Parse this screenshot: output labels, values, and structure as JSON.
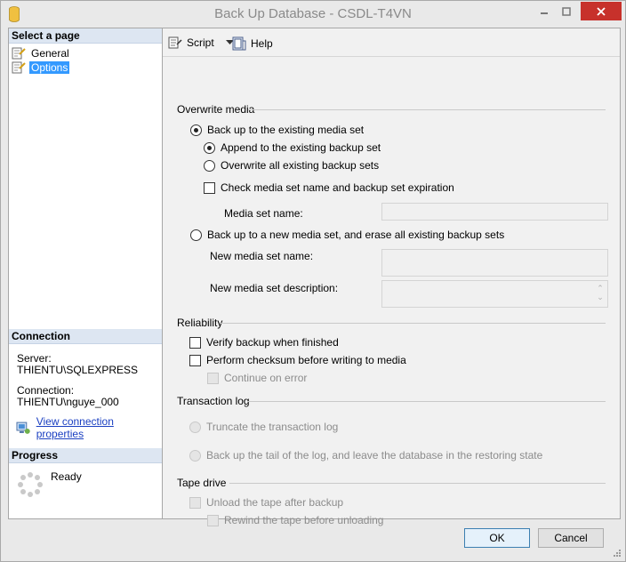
{
  "window": {
    "title": "Back Up Database - CSDL-T4VN"
  },
  "left": {
    "select_page_header": "Select a page",
    "pages": [
      {
        "label": "General"
      },
      {
        "label": "Options"
      }
    ],
    "connection_header": "Connection",
    "server_label": "Server:",
    "server_value": "THIENTU\\SQLEXPRESS",
    "connection_label": "Connection:",
    "connection_value": "THIENTU\\nguye_000",
    "view_props_link": "View connection properties",
    "progress_header": "Progress",
    "progress_status": "Ready"
  },
  "toolbar": {
    "script_label": "Script",
    "help_label": "Help"
  },
  "overwrite_media": {
    "title": "Overwrite media",
    "existing_set_label": "Back up to the existing media set",
    "append_label": "Append to the existing backup set",
    "overwrite_label": "Overwrite all existing backup sets",
    "check_media_label": "Check media set name and backup set expiration",
    "media_set_name_label": "Media set name:",
    "media_set_name_value": "",
    "new_media_set_label": "Back up to a new media set, and erase all existing backup sets",
    "new_media_set_name_label": "New media set name:",
    "new_media_set_name_value": "",
    "new_media_set_desc_label": "New media set description:",
    "new_media_set_desc_value": ""
  },
  "reliability": {
    "title": "Reliability",
    "verify_label": "Verify backup when finished",
    "checksum_label": "Perform checksum before writing to media",
    "continue_label": "Continue on error"
  },
  "transaction_log": {
    "title": "Transaction log",
    "truncate_label": "Truncate the transaction log",
    "tail_label": "Back up the tail of the log, and leave the database in the restoring state"
  },
  "tape_drive": {
    "title": "Tape drive",
    "unload_label": "Unload the tape after backup",
    "rewind_label": "Rewind the tape before unloading"
  },
  "buttons": {
    "ok_label": "OK",
    "cancel_label": "Cancel"
  },
  "colors": {
    "selection": "#3399ff",
    "close_button": "#c7312b",
    "link": "#1a3fc1",
    "section_header": "#dde6f2"
  }
}
